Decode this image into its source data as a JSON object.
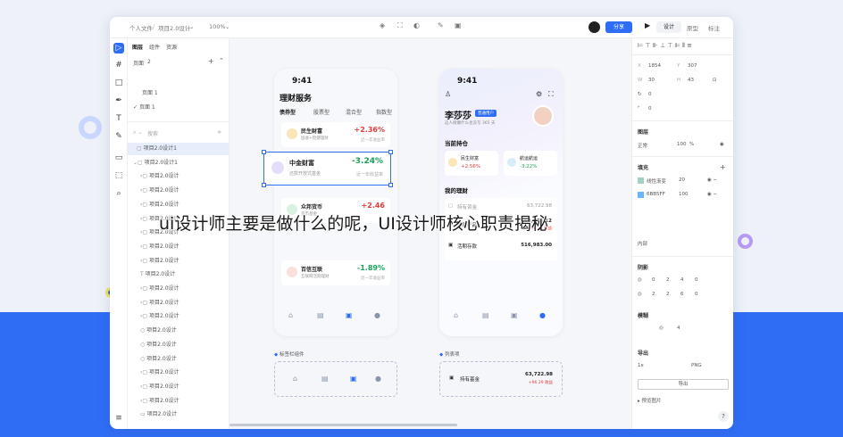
{
  "overlay_title": "ui设计师主要是做什么的呢，UI设计师核心职责揭秘",
  "topbar": {
    "breadcrumb_personal": "个人文件",
    "breadcrumb_project": "项目2.0设计",
    "zoom": "100%",
    "share_label": "分享",
    "mode_tabs": [
      "设计",
      "原型",
      "标注"
    ]
  },
  "layers": {
    "tabs": [
      "图层",
      "组件",
      "资源"
    ],
    "pages_label": "页面",
    "pages_count": "2",
    "page_items": [
      "页面 1",
      "页面 1"
    ],
    "search_placeholder": "搜索",
    "rows": [
      "项目2.0设计1",
      "项目2.0设计1",
      "项目2.0设计",
      "项目2.0设计",
      "项目2.0设计",
      "项目2.0设计",
      "项目2.0设计",
      "项目2.0设计",
      "项目2.0设计",
      "项目2.0设计",
      "项目2.0设计",
      "项目2.0设计",
      "项目2.0设计",
      "项目2.0设计",
      "项目2.0设计",
      "项目2.0设计",
      "项目2.0设计",
      "项目2.0设计",
      "项目2.0设计",
      "项目2.0设计"
    ]
  },
  "phone1": {
    "time": "9:41",
    "title": "理财服务",
    "tabs": [
      "债券型",
      "股票型",
      "混合型",
      "指数型"
    ],
    "funds": [
      {
        "name": "民生财富",
        "sub": "固收+稳健理财",
        "pct": "+2.36%",
        "sub2": "近一年收益率"
      },
      {
        "name": "中金财富",
        "sub": "还款开放式基金",
        "pct": "-3.24%",
        "sub2": "近一年收益率"
      },
      {
        "name": "众邦货币",
        "sub": "货币基金",
        "pct": "+2.46",
        "sub2": ""
      },
      {
        "name": "百信互联",
        "sub": "互联网活期理财",
        "pct": "-1.89%",
        "sub2": "近一年收益率"
      }
    ]
  },
  "phone2": {
    "time": "9:41",
    "name": "李莎莎",
    "badge": "普通用户",
    "desc": "这人很懒什么也没写 365 天",
    "section1": "当前持仓",
    "holdings": [
      {
        "name": "民生财富",
        "pct": "+2.56%"
      },
      {
        "name": "航运航运",
        "pct": "-3.22%"
      }
    ],
    "section2": "我的理财",
    "rows": [
      {
        "name": "持有资金",
        "value": "63,722.98"
      },
      {
        "name": "理财产品",
        "value": "168,875.12",
        "sub": "+96.29 收益"
      },
      {
        "name": "活期存款",
        "value": "516,983.00"
      }
    ]
  },
  "component_label1": "标签栏组件",
  "component_label2": "列表项",
  "component_item": "持有基金",
  "component_value": "63,722.98",
  "component_sub": "+96.29 收益",
  "right_panel": {
    "x": "1854",
    "y": "307",
    "w": "30",
    "h": "43",
    "rot": "0",
    "radius": "0",
    "layer_label": "图层",
    "blend": "正常",
    "opacity": "100",
    "fill_label": "填充",
    "fills": [
      {
        "name": "线性渐变",
        "val": "20"
      },
      {
        "name": "6BB5FF",
        "val": "100"
      }
    ],
    "stroke_inner": "内部",
    "shadow_label": "阴影",
    "shadow_rows": [
      [
        "0",
        "2",
        "4",
        "0"
      ],
      [
        "2",
        "2",
        "6",
        "0"
      ]
    ],
    "blur_label": "模糊",
    "blur_val": "4",
    "export_label": "导出",
    "export_scale": "1x",
    "export_fmt": "PNG",
    "export_btn": "导出",
    "preview": "预览图片",
    "help": "?"
  },
  "colors": {
    "accent": "#2f6df5",
    "bg": "#eef1f8",
    "red": "#e23b3b",
    "green": "#1aa35a"
  }
}
